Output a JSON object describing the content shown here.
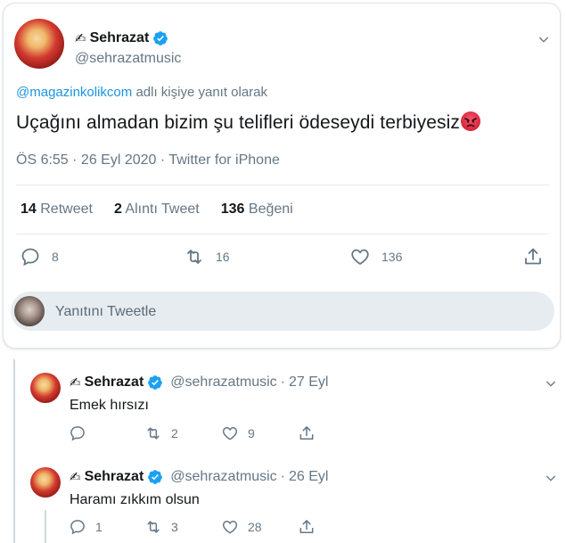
{
  "main_tweet": {
    "display_name": "Sehrazat",
    "name_prefix_icon": "writing-hand-emoji",
    "handle": "@sehrazatmusic",
    "reply_mention": "@magazinkolikcom",
    "reply_suffix": "adlı kişiye yanıt olarak",
    "text": "Uçağını almadan bizim şu telifleri ödeseydi terbiyesiz",
    "text_emoji": "angry-face-emoji",
    "meta": "ÖS 6:55 · 26 Eyl 2020 · Twitter for iPhone",
    "stats": {
      "retweets_count": "14",
      "retweets_label": "Retweet",
      "quotes_count": "2",
      "quotes_label": "Alıntı Tweet",
      "likes_count": "136",
      "likes_label": "Beğeni"
    },
    "actions": {
      "reply_count": "8",
      "retweet_count": "16",
      "like_count": "136"
    }
  },
  "reply_box": {
    "placeholder": "Yanıtını Tweetle"
  },
  "replies": [
    {
      "display_name": "Sehrazat",
      "handle": "@sehrazatmusic",
      "separator": "·",
      "date": "27 Eyl",
      "text": "Emek hırsızı",
      "reply_count": "",
      "retweet_count": "2",
      "like_count": "9"
    },
    {
      "display_name": "Sehrazat",
      "handle": "@sehrazatmusic",
      "separator": "·",
      "date": "26 Eyl",
      "text": "Haramı zıkkım olsun",
      "reply_count": "1",
      "retweet_count": "3",
      "like_count": "28"
    }
  ],
  "colors": {
    "accent": "#1da1f2",
    "text_primary": "#14171a",
    "text_secondary": "#657786",
    "divider": "#e6ecf0",
    "reply_box_bg": "#e6ecf0"
  }
}
